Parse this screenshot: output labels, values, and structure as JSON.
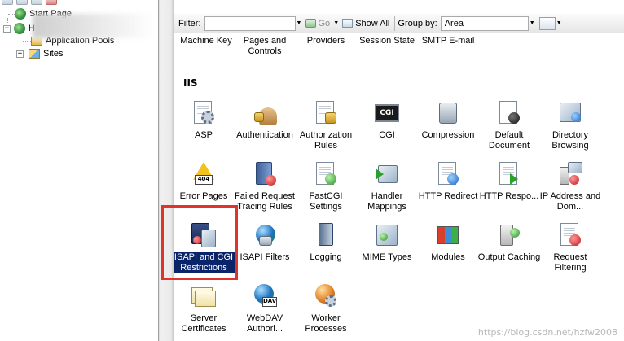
{
  "tree": {
    "nodes": [
      {
        "label": "Start Page"
      },
      {
        "label": "H"
      },
      {
        "label": "Application Pools"
      },
      {
        "label": "Sites"
      }
    ],
    "expanders": [
      "−",
      "+"
    ]
  },
  "filter_bar": {
    "filter_label": "Filter:",
    "filter_value": "",
    "go_label": "Go",
    "show_all_label": "Show All",
    "group_by_label": "Group by:",
    "group_by_value": "Area"
  },
  "top_row": [
    "Machine Key",
    "Pages and Controls",
    "Providers",
    "Session State",
    "SMTP E-mail"
  ],
  "group": {
    "title": "IIS"
  },
  "features": [
    {
      "label": "ASP",
      "icon": "asp-icon"
    },
    {
      "label": "Authentication",
      "icon": "authentication-icon"
    },
    {
      "label": "Authorization Rules",
      "icon": "authorization-rules-icon"
    },
    {
      "label": "CGI",
      "icon": "cgi-icon",
      "text": "CGI"
    },
    {
      "label": "Compression",
      "icon": "compression-icon"
    },
    {
      "label": "Default Document",
      "icon": "default-document-icon"
    },
    {
      "label": "Directory Browsing",
      "icon": "directory-browsing-icon"
    },
    {
      "label": "Error Pages",
      "icon": "error-pages-icon",
      "text": "404"
    },
    {
      "label": "Failed Request Tracing Rules",
      "icon": "failed-request-tracing-icon"
    },
    {
      "label": "FastCGI Settings",
      "icon": "fastcgi-settings-icon"
    },
    {
      "label": "Handler Mappings",
      "icon": "handler-mappings-icon"
    },
    {
      "label": "HTTP Redirect",
      "icon": "http-redirect-icon"
    },
    {
      "label": "HTTP Respo...",
      "icon": "http-response-headers-icon"
    },
    {
      "label": "IP Address and Dom...",
      "icon": "ip-address-domain-icon"
    },
    {
      "label": "ISAPI and CGI Restrictions",
      "icon": "isapi-cgi-restrictions-icon",
      "selected": true
    },
    {
      "label": "ISAPI Filters",
      "icon": "isapi-filters-icon"
    },
    {
      "label": "Logging",
      "icon": "logging-icon"
    },
    {
      "label": "MIME Types",
      "icon": "mime-types-icon"
    },
    {
      "label": "Modules",
      "icon": "modules-icon"
    },
    {
      "label": "Output Caching",
      "icon": "output-caching-icon"
    },
    {
      "label": "Request Filtering",
      "icon": "request-filtering-icon"
    },
    {
      "label": "Server Certificates",
      "icon": "server-certificates-icon"
    },
    {
      "label": "WebDAV Authori...",
      "icon": "webdav-authoring-icon",
      "text": "DAV"
    },
    {
      "label": "Worker Processes",
      "icon": "worker-processes-icon"
    }
  ],
  "watermark": "https://blog.csdn.net/hzfw2008",
  "colors": {
    "selection_bg": "#0a246a",
    "highlight_box": "#e0332b"
  }
}
